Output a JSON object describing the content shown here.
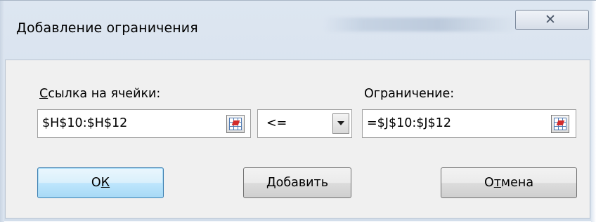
{
  "dialog": {
    "title": "Добавление ограничения",
    "close_icon": "close-icon"
  },
  "cell_ref": {
    "label_accel": "С",
    "label_rest": "сылка на ячейки:",
    "value": "$H$10:$H$12",
    "picker_icon": "range-select-icon"
  },
  "operator": {
    "value": "<=",
    "arrow_icon": "chevron-down-icon"
  },
  "constraint": {
    "label": "Ограничение:",
    "value": "=$J$10:$J$12",
    "picker_icon": "range-select-icon"
  },
  "buttons": {
    "ok_pre": "О",
    "ok_accel": "К",
    "add_accel": "Д",
    "add_rest": "обавить",
    "cancel_pre": "О",
    "cancel_accel": "т",
    "cancel_rest": "мена"
  },
  "colors": {
    "frame": "#d3deeb",
    "panel": "#f0f0f0",
    "default_button": "#bee6fd",
    "picker_arrow": "#d22b2b"
  }
}
